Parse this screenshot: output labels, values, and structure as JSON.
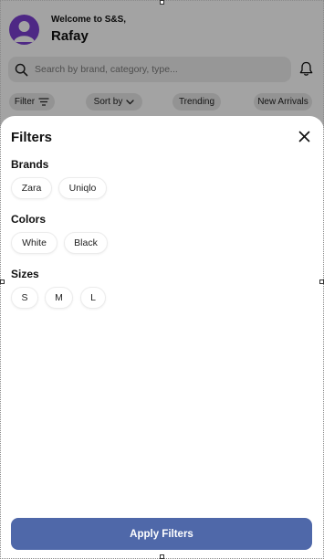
{
  "header": {
    "welcome": "Welcome to S&S,",
    "user_name": "Rafay"
  },
  "search": {
    "placeholder": "Search by brand, category, type..."
  },
  "toolbar": {
    "filter_label": "Filter",
    "sort_label": "Sort by",
    "trending_label": "Trending",
    "new_arrivals_label": "New Arrivals"
  },
  "sheet": {
    "title": "Filters",
    "brands": {
      "label": "Brands",
      "options": [
        "Zara",
        "Uniqlo"
      ]
    },
    "colors": {
      "label": "Colors",
      "options": [
        "White",
        "Black"
      ]
    },
    "sizes": {
      "label": "Sizes",
      "options": [
        "S",
        "M",
        "L"
      ]
    },
    "apply_label": "Apply Filters"
  },
  "colors": {
    "accent": "#4f68a9",
    "avatar": "#7b3fd1"
  },
  "icons": [
    "user-avatar-icon",
    "bell-icon",
    "search-icon",
    "filter-lines-icon",
    "chevron-down-icon",
    "close-icon"
  ]
}
